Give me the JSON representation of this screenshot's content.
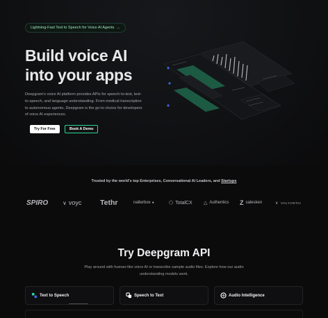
{
  "hero": {
    "announcement": "Lightning-Fast Text to Speech for Voice AI Agents",
    "announcement_arrow": "→",
    "title_line1": "Build voice AI",
    "title_line2": "into your apps",
    "description": "Deepgram's voice AI platform provides APIs for speech-to-text, text-to-speech, and language understanding. From medical transcription to autonomous agents, Deepgram is the go-to choice for developers of voice AI experiences.",
    "primary_button": "Try For Free",
    "secondary_button": "Book A Demo"
  },
  "trusted": {
    "text": "Trusted by the world's top Enterprises, Conversational AI Leaders, and",
    "link": "Startups"
  },
  "logos": [
    "SPIRO",
    "voyc",
    "Tethr",
    "nalterbox",
    "TotalCX",
    "Authentics",
    "salesken",
    "VALYANTAI"
  ],
  "try_section": {
    "title": "Try Deepgram API",
    "description": "Play around with human-like voice AI or transcribe sample audio files. Explore how our audio understanding models work.",
    "tabs": [
      {
        "label": "Text to Speech",
        "icon": "text-to-speech-icon"
      },
      {
        "label": "Speech to Text",
        "icon": "speech-to-text-icon"
      },
      {
        "label": "Audio Intelligence",
        "icon": "audio-intelligence-icon"
      }
    ]
  },
  "colors": {
    "accent": "#2bd99a",
    "background": "#0b0b0c",
    "badge_text": "#9ee6c2"
  }
}
